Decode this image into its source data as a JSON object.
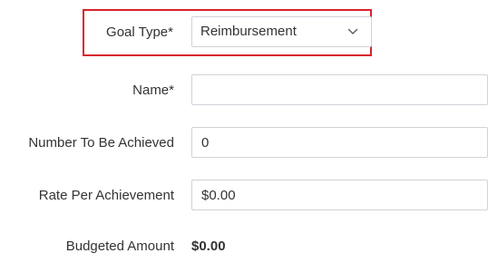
{
  "form": {
    "goal_type": {
      "label": "Goal Type*",
      "selected_value": "Reimbursement",
      "chevron_icon": "chevron-down-icon"
    },
    "name": {
      "label": "Name*",
      "value": ""
    },
    "number_to_be_achieved": {
      "label": "Number To Be Achieved",
      "value": "0"
    },
    "rate_per_achievement": {
      "label": "Rate Per Achievement",
      "value": "$0.00"
    },
    "budgeted_amount": {
      "label": "Budgeted Amount",
      "value": "$0.00"
    }
  },
  "colors": {
    "highlight_border": "#d9232d",
    "field_border": "#cfd3d7",
    "text": "#333333"
  }
}
